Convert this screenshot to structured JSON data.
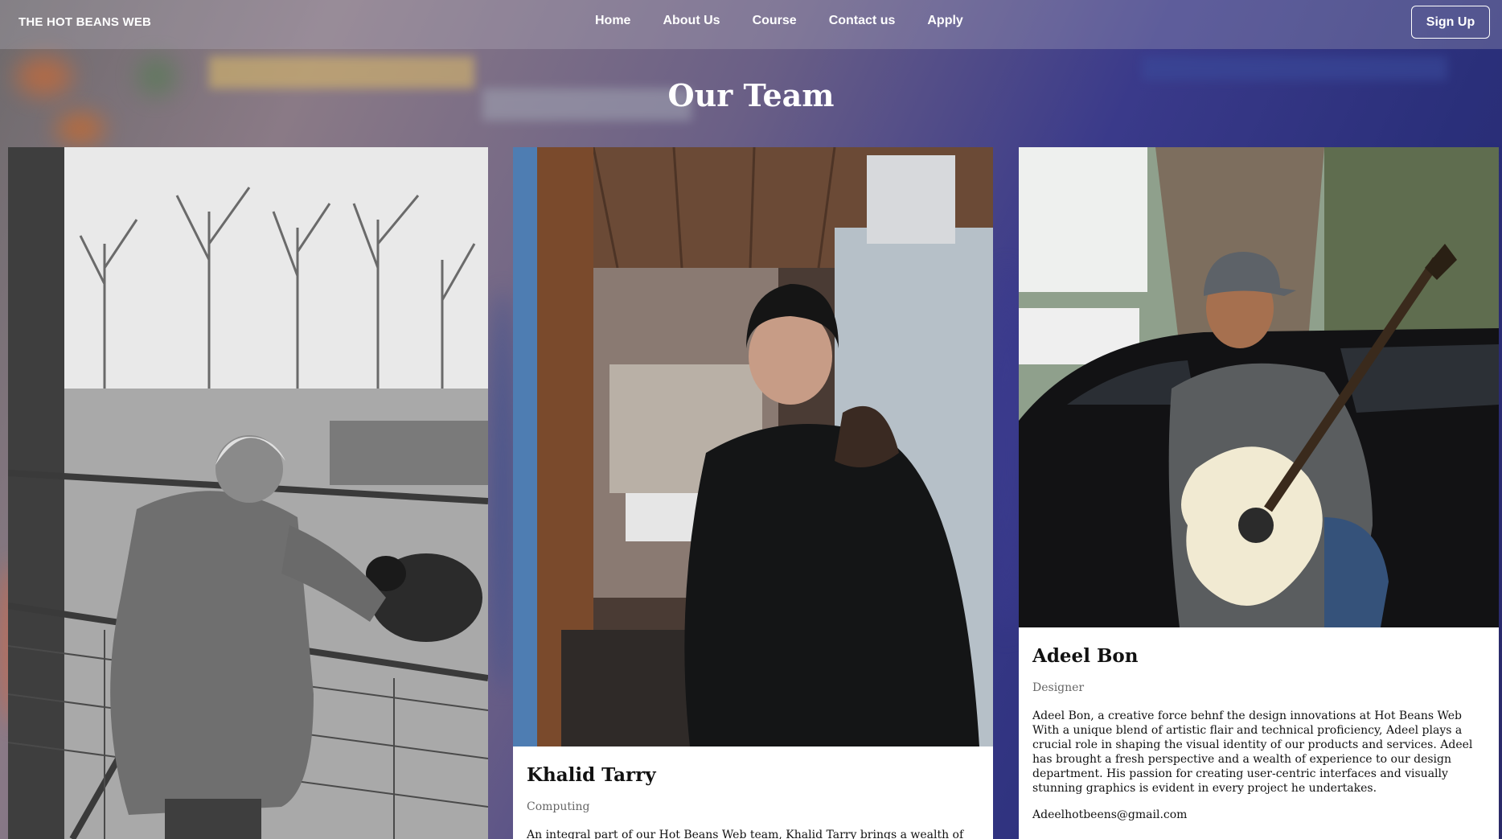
{
  "nav": {
    "brand": "THE HOT BEANS WEB",
    "links": [
      "Home",
      "About Us",
      "Course",
      "Contact us",
      "Apply"
    ],
    "signup_label": "Sign Up"
  },
  "page": {
    "title": "Our Team"
  },
  "team": [
    {
      "photo_alt": "black-and-white portrait of an elderly man leaning on a farm gate with sheep"
    },
    {
      "name": "Khalid Tarry",
      "role": "Computing",
      "bio": "An integral part of our Hot Beans Web team, Khalid Tarry brings a wealth of",
      "photo_alt": "portrait of a young man in a black beanie and winter jacket"
    },
    {
      "name": "Adeel Bon",
      "role": "Designer",
      "bio": "Adeel Bon, a creative force behnf the design innovations at Hot Beans Web With a unique blend of artistic flair and technical proficiency, Adeel plays a crucial role in shaping the visual identity of our products and services. Adeel has brought a fresh perspective and a wealth of experience to our design department. His passion for creating user-centric interfaces and visually stunning graphics is evident in every project he undertakes.",
      "email": "Adeelhotbeens@gmail.com",
      "photo_alt": "smiling man in a cap holding an acoustic guitar in front of a black car"
    }
  ],
  "colors": {
    "nav_text": "#ffffff",
    "card_bg": "#ffffff",
    "role_text": "#666666"
  }
}
